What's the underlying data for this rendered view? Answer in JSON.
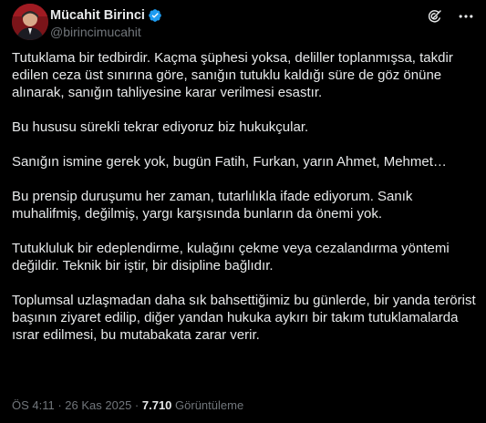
{
  "author": {
    "display_name": "Mücahit Birinci",
    "handle": "@birincimucahit",
    "verified_color": "#1d9bf0"
  },
  "header_actions": {
    "grok_icon": "grok-icon",
    "more_icon": "more-icon"
  },
  "tweet": {
    "paragraphs": [
      "Tutuklama bir tedbirdir. Kaçma şüphesi yoksa, deliller toplanmışsa, takdir edilen ceza üst sınırına göre, sanığın tutuklu kaldığı süre de göz önüne alınarak, sanığın tahliyesine karar verilmesi esastır.",
      "Bu hususu sürekli tekrar ediyoruz biz hukukçular.",
      "Sanığın ismine gerek yok, bugün Fatih, Furkan, yarın Ahmet, Mehmet…",
      "Bu prensip duruşumu her zaman, tutarlılıkla  ifade ediyorum. Sanık muhalifmiş, değilmiş, yargı karşısında bunların da önemi yok.",
      "Tutukluluk bir edeplendirme, kulağını çekme veya cezalandırma yöntemi değildir. Teknik bir iştir, bir disipline bağlıdır.",
      "Toplumsal uzlaşmadan daha sık bahsettiğimiz bu günlerde, bir yanda terörist başının ziyaret edilip, diğer yandan hukuka aykırı bir takım tutuklamalarda ısrar edilmesi, bu mutabakata zarar verir."
    ]
  },
  "footer": {
    "time": "ÖS 4:11",
    "sep1": " · ",
    "date": "26 Kas 2025",
    "sep2": " · ",
    "views_count": "7.710",
    "views_label": " Görüntüleme"
  }
}
